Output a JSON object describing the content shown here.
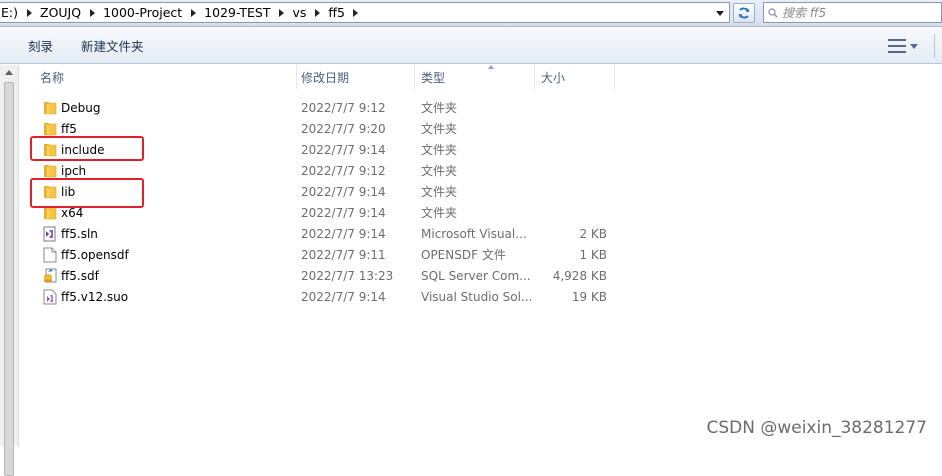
{
  "address": {
    "crumbs": [
      "E:)",
      "ZOUJQ",
      "1000-Project",
      "1029-TEST",
      "vs",
      "ff5"
    ]
  },
  "search": {
    "placeholder": "搜索 ff5"
  },
  "toolbar": {
    "organize_label": "刻录",
    "new_folder_label": "新建文件夹"
  },
  "columns": {
    "name": "名称",
    "date": "修改日期",
    "type": "类型",
    "size": "大小"
  },
  "files": [
    {
      "name": "Debug",
      "date": "2022/7/7 9:12",
      "type": "文件夹",
      "size": "",
      "icon": "folder-icon"
    },
    {
      "name": "ff5",
      "date": "2022/7/7 9:20",
      "type": "文件夹",
      "size": "",
      "icon": "folder-icon"
    },
    {
      "name": "include",
      "date": "2022/7/7 9:14",
      "type": "文件夹",
      "size": "",
      "icon": "folder-icon"
    },
    {
      "name": "ipch",
      "date": "2022/7/7 9:12",
      "type": "文件夹",
      "size": "",
      "icon": "folder-icon"
    },
    {
      "name": "lib",
      "date": "2022/7/7 9:14",
      "type": "文件夹",
      "size": "",
      "icon": "folder-icon"
    },
    {
      "name": "x64",
      "date": "2022/7/7 9:14",
      "type": "文件夹",
      "size": "",
      "icon": "folder-icon"
    },
    {
      "name": "ff5.sln",
      "date": "2022/7/7 9:14",
      "type": "Microsoft Visual...",
      "size": "2 KB",
      "icon": "visual-studio-solution-icon"
    },
    {
      "name": "ff5.opensdf",
      "date": "2022/7/7 9:11",
      "type": "OPENSDF 文件",
      "size": "1 KB",
      "icon": "blank-file-icon"
    },
    {
      "name": "ff5.sdf",
      "date": "2022/7/7 13:23",
      "type": "SQL Server Com...",
      "size": "4,928 KB",
      "icon": "database-file-icon"
    },
    {
      "name": "ff5.v12.suo",
      "date": "2022/7/7 9:14",
      "type": "Visual Studio Sol...",
      "size": "19 KB",
      "icon": "suo-file-icon"
    }
  ],
  "watermark": "CSDN @weixin_38281277",
  "colors": {
    "highlight": "#e0202a",
    "folder": "#f4c545"
  }
}
